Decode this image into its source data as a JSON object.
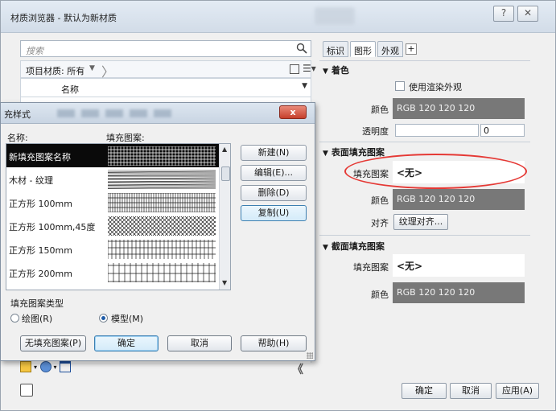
{
  "window": {
    "title": "材质浏览器 - 默认为新材质",
    "help_btn": "?",
    "close_btn": "✕"
  },
  "browser": {
    "search_placeholder": "搜索",
    "filter_label": "项目材质: 所有",
    "filter_caret": "▼",
    "column_header": "名称",
    "collapse": "《"
  },
  "tabs": [
    {
      "label": "标识"
    },
    {
      "label": "图形"
    },
    {
      "label": "外观"
    }
  ],
  "tab_add": "+",
  "shading": {
    "header": "着色",
    "use_render_label": "使用渲染外观",
    "color_label": "颜色",
    "color_value": "RGB 120 120 120",
    "transparency_label": "透明度",
    "transparency_value": "0"
  },
  "surface_pattern": {
    "header": "表面填充图案",
    "pattern_label": "填充图案",
    "pattern_value": "<无>",
    "color_label": "颜色",
    "color_value": "RGB 120 120 120",
    "align_label": "对齐",
    "align_button": "纹理对齐..."
  },
  "cut_pattern": {
    "header": "截面填充图案",
    "pattern_label": "填充图案",
    "pattern_value": "<无>",
    "color_label": "颜色",
    "color_value": "RGB 120 120 120"
  },
  "footer": {
    "ok": "确定",
    "cancel": "取消",
    "apply": "应用(A)"
  },
  "dialog": {
    "title": "充样式",
    "close": "x",
    "name_col": "名称:",
    "fill_col": "填充图案:",
    "patterns": [
      {
        "name": "新填充图案名称",
        "swatch": "grid-fine",
        "selected": true
      },
      {
        "name": "木材 - 纹理",
        "swatch": "wood",
        "selected": false
      },
      {
        "name": "正方形 100mm",
        "swatch": "grid-dense",
        "selected": false
      },
      {
        "name": "正方形 100mm,45度",
        "swatch": "crosshatch",
        "selected": false
      },
      {
        "name": "正方形 150mm",
        "swatch": "grid-medium",
        "selected": false
      },
      {
        "name": "正方形 200mm",
        "swatch": "grid-coarse",
        "selected": false
      }
    ],
    "buttons": {
      "new": "新建(N)",
      "edit": "编辑(E)...",
      "delete": "删除(D)",
      "copy": "复制(U)"
    },
    "type_group": "填充图案类型",
    "type_drafting": "绘图(R)",
    "type_model": "模型(M)",
    "type_selected": "model",
    "no_pattern": "无填充图案(P)",
    "ok": "确定",
    "cancel": "取消",
    "help": "帮助(H)"
  },
  "colors": {
    "swatch_gray": "#787878",
    "highlight": "#e53935",
    "selected_row": "#0a0a0a"
  }
}
